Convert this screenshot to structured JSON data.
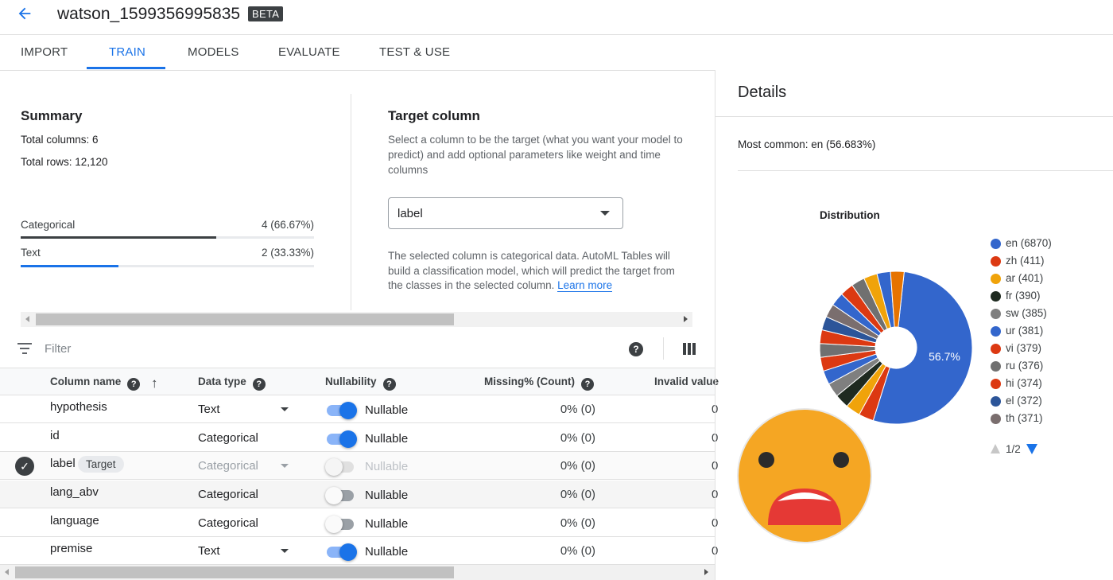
{
  "header": {
    "title": "watson_1599356995835",
    "badge": "BETA"
  },
  "tabs": [
    {
      "label": "IMPORT",
      "active": false
    },
    {
      "label": "TRAIN",
      "active": true
    },
    {
      "label": "MODELS",
      "active": false
    },
    {
      "label": "EVALUATE",
      "active": false
    },
    {
      "label": "TEST & USE",
      "active": false
    }
  ],
  "summary": {
    "title": "Summary",
    "total_columns": "Total columns: 6",
    "total_rows": "Total rows: 12,120",
    "types": [
      {
        "label": "Categorical",
        "value": "4 (66.67%)",
        "fraction": 0.6667,
        "color": "#3c4043"
      },
      {
        "label": "Text",
        "value": "2 (33.33%)",
        "fraction": 0.3333,
        "color": "#1a73e8"
      }
    ]
  },
  "target": {
    "title": "Target column",
    "description": "Select a column to be the target (what you want your model to predict) and add optional parameters like weight and time columns",
    "selected": "label",
    "note": "The selected column is categorical data. AutoML Tables will build a classification model, which will predict the target from the classes in the selected column.",
    "learn_more": "Learn more"
  },
  "filter": {
    "placeholder": "Filter",
    "help": "?"
  },
  "table": {
    "headers": {
      "name": "Column name",
      "type": "Data type",
      "nullability": "Nullability",
      "missing": "Missing% (Count)",
      "invalid": "Invalid value"
    },
    "rows": [
      {
        "name": "hypothesis",
        "type": "Text",
        "nullable": "Nullable",
        "missing": "0% (0)",
        "trail": "0"
      },
      {
        "name": "id",
        "type": "Categorical",
        "nullable": "Nullable",
        "missing": "0% (0)",
        "trail": "0"
      },
      {
        "name": "label",
        "chip": "Target",
        "type": "Categorical",
        "nullable": "Nullable",
        "missing": "0% (0)",
        "trail": "0"
      },
      {
        "name": "lang_abv",
        "type": "Categorical",
        "nullable": "Nullable",
        "missing": "0% (0)",
        "trail": "0"
      },
      {
        "name": "language",
        "type": "Categorical",
        "nullable": "Nullable",
        "missing": "0% (0)",
        "trail": "0"
      },
      {
        "name": "premise",
        "type": "Text",
        "nullable": "Nullable",
        "missing": "0% (0)",
        "trail": "0"
      }
    ]
  },
  "details": {
    "title": "Details",
    "most_common": "Most common: en (56.683%)",
    "distribution_title": "Distribution",
    "center_label": "56.7%",
    "pager": "1/2"
  },
  "chart_data": {
    "type": "pie",
    "title": "Distribution",
    "slices": [
      {
        "label": "en (6870)",
        "value": 6870,
        "color": "#3366cc"
      },
      {
        "label": "zh (411)",
        "value": 411,
        "color": "#dc3912"
      },
      {
        "label": "ar (401)",
        "value": 401,
        "color": "#f0a30a"
      },
      {
        "label": "fr (390)",
        "value": 390,
        "color": "#1f2a20"
      },
      {
        "label": "sw (385)",
        "value": 385,
        "color": "#7f7f7f"
      },
      {
        "label": "ur (381)",
        "value": 381,
        "color": "#3366cc"
      },
      {
        "label": "vi (379)",
        "value": 379,
        "color": "#dc3912"
      },
      {
        "label": "ru (376)",
        "value": 376,
        "color": "#707070"
      },
      {
        "label": "hi (374)",
        "value": 374,
        "color": "#dc3912"
      },
      {
        "label": "el (372)",
        "value": 372,
        "color": "#2c5599"
      },
      {
        "label": "th (371)",
        "value": 371,
        "color": "#7a6e6e"
      },
      {
        "label": "",
        "value": 371,
        "color": "#3366cc"
      },
      {
        "label": "",
        "value": 371,
        "color": "#dc3912"
      },
      {
        "label": "",
        "value": 371,
        "color": "#707070"
      },
      {
        "label": "",
        "value": 371,
        "color": "#f0a30a"
      },
      {
        "label": "",
        "value": 371,
        "color": "#3366cc"
      },
      {
        "label": "",
        "value": 371,
        "color": "#e67300"
      }
    ],
    "legend_count": 11,
    "legend_position": "right"
  }
}
